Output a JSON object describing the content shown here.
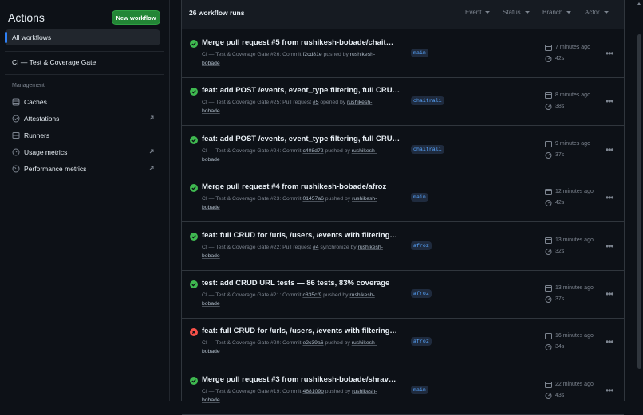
{
  "sidebar": {
    "title": "Actions",
    "new_workflow_label": "New workflow",
    "all_workflows_label": "All workflows",
    "workflow_label": "CI — Test & Coverage Gate",
    "management_label": "Management",
    "items": [
      {
        "label": "Caches",
        "icon": "cache-icon",
        "external": false
      },
      {
        "label": "Attestations",
        "icon": "attestation-icon",
        "external": true
      },
      {
        "label": "Runners",
        "icon": "runner-icon",
        "external": false
      },
      {
        "label": "Usage metrics",
        "icon": "usage-icon",
        "external": true
      },
      {
        "label": "Performance metrics",
        "icon": "performance-icon",
        "external": true
      }
    ]
  },
  "header": {
    "count_label": "26 workflow runs",
    "filters": [
      "Event",
      "Status",
      "Branch",
      "Actor"
    ]
  },
  "runs": [
    {
      "status": "success",
      "title": "Merge pull request #5 from rushikesh-bobade/chait…",
      "workflow": "CI — Test & Coverage Gate",
      "run_text": "#26: Commit",
      "ref": "f2cd81e",
      "action": "pushed by",
      "user": "rushikesh-",
      "user2": "bobade",
      "branch": "main",
      "time": "7 minutes ago",
      "duration": "42s"
    },
    {
      "status": "success",
      "title": "feat: add POST /events, event_type filtering, full CRU…",
      "workflow": "CI — Test & Coverage Gate",
      "run_text": "#25: Pull request",
      "ref": "#5",
      "action": "opened by",
      "user": "rushikesh-",
      "user2": "bobade",
      "branch": "chaitrali",
      "time": "8 minutes ago",
      "duration": "38s"
    },
    {
      "status": "success",
      "title": "feat: add POST /events, event_type filtering, full CRU…",
      "workflow": "CI — Test & Coverage Gate",
      "run_text": "#24: Commit",
      "ref": "c408d72",
      "action": "pushed by",
      "user": "rushikesh-",
      "user2": "bobade",
      "branch": "chaitrali",
      "time": "9 minutes ago",
      "duration": "37s"
    },
    {
      "status": "success",
      "title": "Merge pull request #4 from rushikesh-bobade/afroz",
      "workflow": "CI — Test & Coverage Gate",
      "run_text": "#23: Commit",
      "ref": "01457a6",
      "action": "pushed by",
      "user": "rushikesh-",
      "user2": "bobade",
      "branch": "main",
      "time": "12 minutes ago",
      "duration": "42s"
    },
    {
      "status": "success",
      "title": "feat: full CRUD for /urls, /users, /events with filtering…",
      "workflow": "CI — Test & Coverage Gate",
      "run_text": "#22: Pull request",
      "ref": "#4",
      "action": "synchronize by",
      "user": "rushikesh-",
      "user2": "bobade",
      "branch": "afroz",
      "time": "13 minutes ago",
      "duration": "32s"
    },
    {
      "status": "success",
      "title": "test: add CRUD URL tests — 86 tests, 83% coverage",
      "workflow": "CI — Test & Coverage Gate",
      "run_text": "#21: Commit",
      "ref": "c835cf9",
      "action": "pushed by",
      "user": "rushikesh-",
      "user2": "bobade",
      "branch": "afroz",
      "time": "13 minutes ago",
      "duration": "37s"
    },
    {
      "status": "failure",
      "title": "feat: full CRUD for /urls, /users, /events with filtering…",
      "workflow": "CI — Test & Coverage Gate",
      "run_text": "#20: Commit",
      "ref": "e2c39a6",
      "action": "pushed by",
      "user": "rushikesh-",
      "user2": "bobade",
      "branch": "afroz",
      "time": "16 minutes ago",
      "duration": "34s"
    },
    {
      "status": "success",
      "title": "Merge pull request #3 from rushikesh-bobade/shrav…",
      "workflow": "CI — Test & Coverage Gate",
      "run_text": "#19: Commit",
      "ref": "468109b",
      "action": "pushed by",
      "user": "rushikesh-",
      "user2": "bobade",
      "branch": "main",
      "time": "22 minutes ago",
      "duration": "43s"
    }
  ],
  "colors": {
    "success": "#3fb950",
    "failure": "#f85149",
    "accent": "#238636"
  }
}
